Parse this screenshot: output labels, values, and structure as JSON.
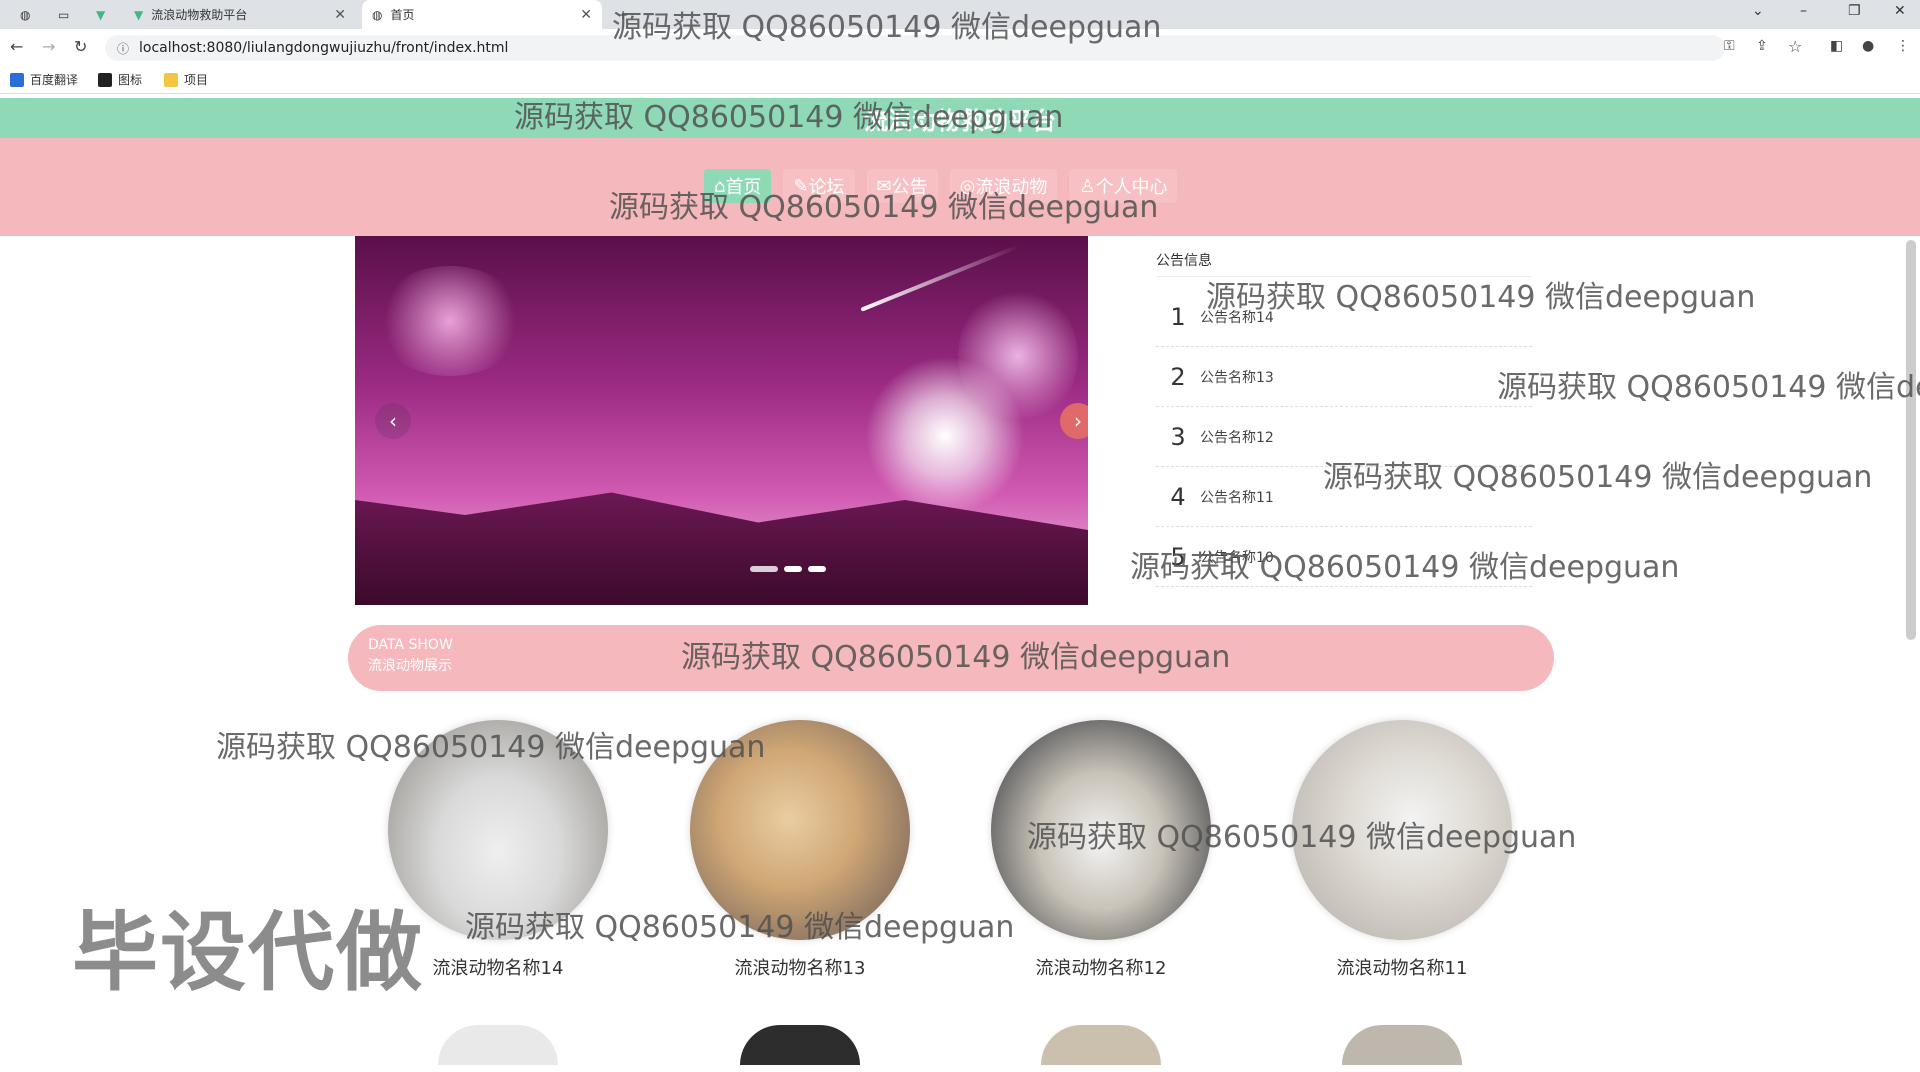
{
  "browser": {
    "tabs": [
      {
        "title": "",
        "active": false
      },
      {
        "title": "",
        "active": false
      },
      {
        "title": "流浪动物救助平台",
        "active": false
      },
      {
        "title": "首页",
        "active": true
      }
    ],
    "url": "localhost:8080/liulangdongwujiuzhu/front/index.html",
    "bookmarks": [
      "百度翻译",
      "图标",
      "项目"
    ]
  },
  "site": {
    "title": "流浪动物救助平台",
    "nav": [
      "首页",
      "论坛",
      "公告",
      "流浪动物",
      "个人中心"
    ]
  },
  "notice": {
    "heading": "公告信息",
    "items": [
      {
        "num": "1",
        "name": "公告名称14"
      },
      {
        "num": "2",
        "name": "公告名称13"
      },
      {
        "num": "3",
        "name": "公告名称12"
      },
      {
        "num": "4",
        "name": "公告名称11"
      },
      {
        "num": "5",
        "name": "公告名称10"
      }
    ]
  },
  "data_show": {
    "en": "DATA SHOW",
    "cn": "流浪动物展示"
  },
  "animals": [
    {
      "name": "流浪动物名称14"
    },
    {
      "name": "流浪动物名称13"
    },
    {
      "name": "流浪动物名称12"
    },
    {
      "name": "流浪动物名称11"
    }
  ],
  "watermark": {
    "text": "源码获取 QQ86050149 微信deepguan",
    "big": "毕设代做"
  },
  "colors": {
    "title_bar": "#8fd9b6",
    "nav_bar": "#f5b8bc",
    "accent": "#8fd9b6"
  }
}
